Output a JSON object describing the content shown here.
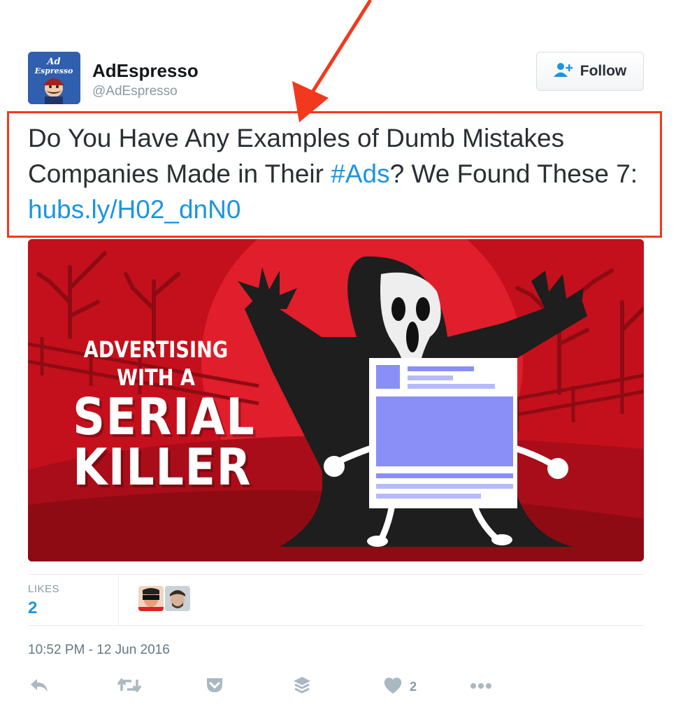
{
  "user": {
    "name": "AdEspresso",
    "handle": "@AdEspresso",
    "avatar_text_1": "Ad",
    "avatar_text_2": "Espresso"
  },
  "follow_button": {
    "label": "Follow",
    "icon": "add-user-icon"
  },
  "tweet": {
    "text_part1": "Do You Have Any Examples of Dumb Mistakes Companies Made in Their ",
    "hashtag": "#Ads",
    "text_part2": "? We Found These 7: ",
    "link": "hubs.ly/H02_dnN0"
  },
  "media": {
    "headline_small": "ADVERTISING WITH A",
    "headline_line1": "SERIAL",
    "headline_line2": "KILLER"
  },
  "stats": {
    "likes_label": "LIKES",
    "likes_count": "2"
  },
  "timestamp": "10:52 PM - 12 Jun 2016",
  "actions": {
    "reply_icon": "reply-icon",
    "retweet_icon": "retweet-icon",
    "pocket_icon": "pocket-icon",
    "buffer_icon": "buffer-icon",
    "like_icon": "heart-icon",
    "like_count": "2",
    "more_icon": "more-icon"
  },
  "colors": {
    "link": "#1b95e0",
    "highlight": "#f2391d",
    "media_bg": "#c4101c"
  }
}
